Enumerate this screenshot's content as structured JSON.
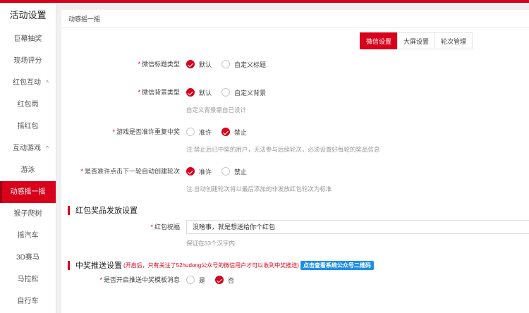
{
  "sidebar": {
    "title": "活动设置",
    "items": [
      {
        "label": "巨幕抽奖",
        "type": "item"
      },
      {
        "label": "现场评分",
        "type": "item"
      },
      {
        "label": "红包互动",
        "type": "group"
      },
      {
        "label": "红包雨",
        "type": "item"
      },
      {
        "label": "摇红包",
        "type": "item"
      },
      {
        "label": "互动游戏",
        "type": "group"
      },
      {
        "label": "游泳",
        "type": "item"
      },
      {
        "label": "动感摇一摇",
        "type": "active"
      },
      {
        "label": "猴子爬树",
        "type": "item"
      },
      {
        "label": "摇汽车",
        "type": "item"
      },
      {
        "label": "3D赛马",
        "type": "item"
      },
      {
        "label": "马拉松",
        "type": "item"
      },
      {
        "label": "自行车",
        "type": "item"
      }
    ],
    "chevron": "^"
  },
  "panel": {
    "header": "动感摇一摇"
  },
  "tabs": [
    "微信设置",
    "大屏设置",
    "轮次管理"
  ],
  "form": {
    "wechat_title_type": {
      "label": "微信标题类型",
      "options": [
        "默认",
        "自定义标题"
      ],
      "selected": 0
    },
    "wechat_bg_type": {
      "label": "微信背景类型",
      "options": [
        "默认",
        "自定义背景"
      ],
      "selected": 0,
      "hint": "自定义背景需自己设计"
    },
    "allow_repeat": {
      "label": "游戏是否准许重复中奖",
      "options": [
        "准许",
        "禁止"
      ],
      "selected": 1,
      "hint": "注:禁止后已中奖的用户，无法参与后续轮次，必须设置好每轮的奖品信息"
    },
    "auto_round": {
      "label": "是否准许点击下一轮自动创建轮次",
      "options": [
        "准许",
        "禁止"
      ],
      "selected": 0,
      "hint": "注:自动创建轮次将以最后添加的非发放红包轮次为标准"
    }
  },
  "redpacket_section": {
    "title": "红包奖品发放设置",
    "greeting_label": "红包祝福",
    "greeting_value": "没啥事，就是想送给你个红包",
    "greeting_hint": "保证在33个汉字内"
  },
  "push_section": {
    "title": "中奖推送设置",
    "note": "(开启后，只有关注了52hudong公众号的微信用户才可以收到中奖推送)",
    "qr_button": "点击查看系统公众号二维码",
    "push_label": "是否开启推送中奖模板消息",
    "options": [
      "是",
      "否"
    ],
    "selected": 1
  },
  "required_mark": "*",
  "colors": {
    "accent": "#d9001b",
    "link_button": "#1e8ee6"
  }
}
